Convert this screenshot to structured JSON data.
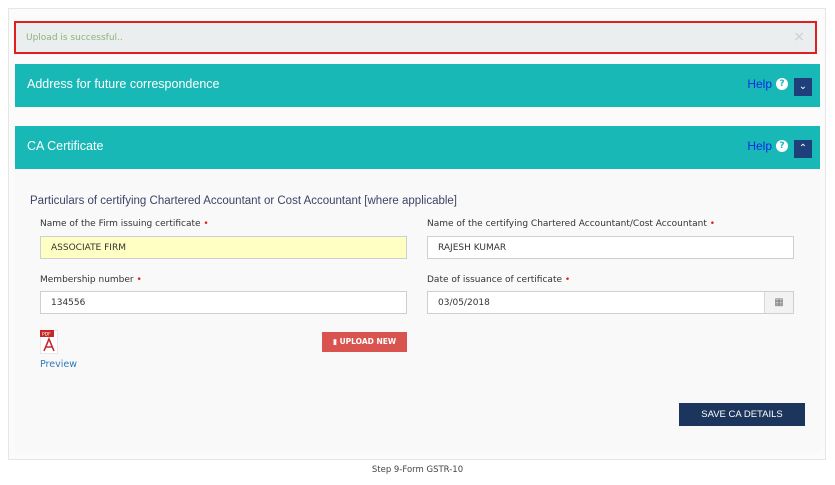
{
  "alert": {
    "message": "Upload is successful..",
    "close": "×"
  },
  "panels": [
    {
      "title": "Address for future correspondence",
      "help": "Help",
      "toggle": "⌄"
    },
    {
      "title": "CA Certificate",
      "help": "Help",
      "toggle": "⌃"
    }
  ],
  "form": {
    "section_title": "Particulars of certifying Chartered Accountant or Cost Accountant [where applicable]",
    "firm_label": "Name of the Firm issuing certificate",
    "firm_value": "ASSOCIATE FIRM",
    "ca_label": "Name of the certifying Chartered Accountant/Cost Accountant",
    "ca_value": "RAJESH KUMAR",
    "membership_label": "Membership number",
    "membership_value": "134556",
    "date_label": "Date of issuance of certificate",
    "date_value": "03/05/2018",
    "required_mark": "•",
    "preview_label": "Preview",
    "upload_label": "UPLOAD NEW",
    "save_label": "SAVE CA DETAILS"
  },
  "caption": "Step 9-Form GSTR-10",
  "colors": {
    "header": "#17b8b5",
    "toggle": "#1f3f7a",
    "alert_border": "#e02020",
    "upload": "#d9534f",
    "save": "#1b355c"
  }
}
